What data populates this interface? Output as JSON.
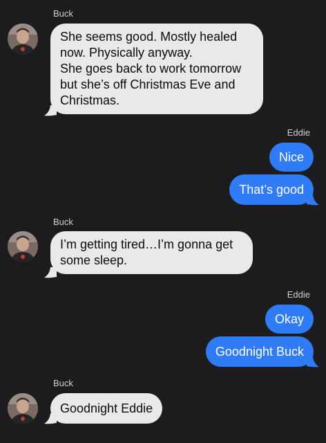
{
  "thread": {
    "groups": [
      {
        "sender": "Buck",
        "messages": [
          {
            "lines": [
              "She seems good. Mostly healed",
              "now. Physically anyway.",
              "She goes back to work tomorrow",
              "but she’s off Christmas Eve and",
              "Christmas."
            ]
          }
        ]
      },
      {
        "sender": "Eddie",
        "messages": [
          {
            "text": "Nice"
          },
          {
            "text": "That’s good"
          }
        ]
      },
      {
        "sender": "Buck",
        "messages": [
          {
            "lines": [
              "I’m getting tired…I’m gonna get",
              "some sleep."
            ]
          }
        ]
      },
      {
        "sender": "Eddie",
        "messages": [
          {
            "text": "Okay"
          },
          {
            "text": "Goodnight Buck"
          }
        ]
      },
      {
        "sender": "Buck",
        "messages": [
          {
            "text": "Goodnight Eddie"
          }
        ]
      }
    ]
  },
  "colors": {
    "background": "#1c1c1e",
    "incoming_bubble": "#e9e9eb",
    "outgoing_bubble": "#2f7cf6"
  },
  "icons": {
    "avatar": "contact-photo"
  }
}
